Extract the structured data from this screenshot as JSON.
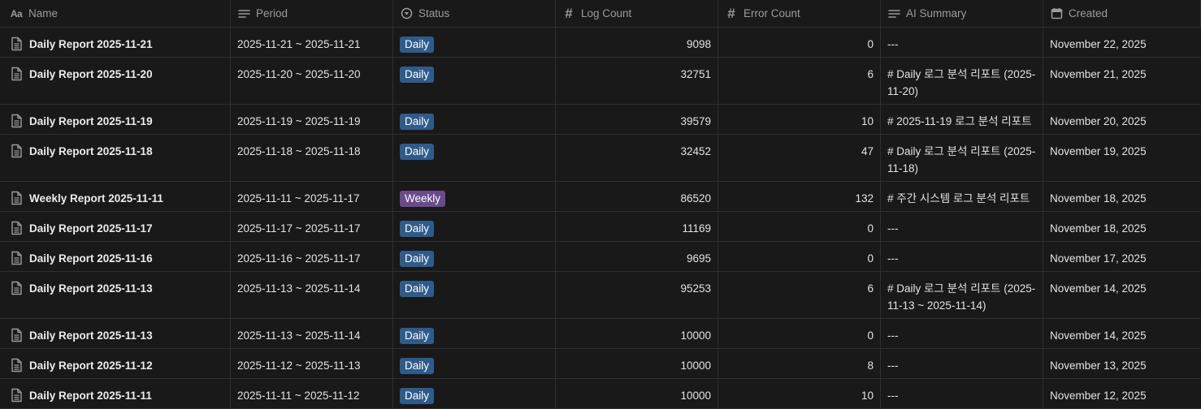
{
  "columns": {
    "name": {
      "label": "Name",
      "icon": "text-aa-icon"
    },
    "period": {
      "label": "Period",
      "icon": "lines-icon"
    },
    "status": {
      "label": "Status",
      "icon": "status-icon"
    },
    "log_count": {
      "label": "Log Count",
      "icon": "hash-icon"
    },
    "error_count": {
      "label": "Error Count",
      "icon": "hash-icon"
    },
    "ai_summary": {
      "label": "AI Summary",
      "icon": "lines-icon"
    },
    "created": {
      "label": "Created",
      "icon": "calendar-icon"
    }
  },
  "status_colors": {
    "Daily": "#2f5b8a",
    "Weekly": "#6a4a8c"
  },
  "rows": [
    {
      "name": "Daily Report 2025-11-21",
      "period": "2025-11-21 ~ 2025-11-21",
      "status": "Daily",
      "log_count": "9098",
      "error_count": "0",
      "ai_summary": "---",
      "created": "November 22, 2025"
    },
    {
      "name": "Daily Report 2025-11-20",
      "period": "2025-11-20 ~ 2025-11-20",
      "status": "Daily",
      "log_count": "32751",
      "error_count": "6",
      "ai_summary": "# Daily 로그 분석 리포트 (2025-11-20)",
      "created": "November 21, 2025"
    },
    {
      "name": "Daily Report 2025-11-19",
      "period": "2025-11-19 ~ 2025-11-19",
      "status": "Daily",
      "log_count": "39579",
      "error_count": "10",
      "ai_summary": "# 2025-11-19 로그 분석 리포트",
      "created": "November 20, 2025"
    },
    {
      "name": "Daily Report 2025-11-18",
      "period": "2025-11-18 ~ 2025-11-18",
      "status": "Daily",
      "log_count": "32452",
      "error_count": "47",
      "ai_summary": "# Daily 로그 분석 리포트 (2025-11-18)",
      "created": "November 19, 2025"
    },
    {
      "name": "Weekly Report 2025-11-11",
      "period": "2025-11-11 ~ 2025-11-17",
      "status": "Weekly",
      "log_count": "86520",
      "error_count": "132",
      "ai_summary": "# 주간 시스템 로그 분석 리포트",
      "created": "November 18, 2025"
    },
    {
      "name": "Daily Report 2025-11-17",
      "period": "2025-11-17 ~ 2025-11-17",
      "status": "Daily",
      "log_count": "11169",
      "error_count": "0",
      "ai_summary": "---",
      "created": "November 18, 2025"
    },
    {
      "name": "Daily Report 2025-11-16",
      "period": "2025-11-16 ~ 2025-11-17",
      "status": "Daily",
      "log_count": "9695",
      "error_count": "0",
      "ai_summary": "---",
      "created": "November 17, 2025"
    },
    {
      "name": "Daily Report 2025-11-13",
      "period": "2025-11-13 ~ 2025-11-14",
      "status": "Daily",
      "log_count": "95253",
      "error_count": "6",
      "ai_summary": "# Daily 로그 분석 리포트 (2025-11-13 ~ 2025-11-14)",
      "created": "November 14, 2025"
    },
    {
      "name": "Daily Report 2025-11-13",
      "period": "2025-11-13 ~ 2025-11-14",
      "status": "Daily",
      "log_count": "10000",
      "error_count": "0",
      "ai_summary": "---",
      "created": "November 14, 2025"
    },
    {
      "name": "Daily Report 2025-11-12",
      "period": "2025-11-12 ~ 2025-11-13",
      "status": "Daily",
      "log_count": "10000",
      "error_count": "8",
      "ai_summary": "---",
      "created": "November 13, 2025"
    },
    {
      "name": "Daily Report 2025-11-11",
      "period": "2025-11-11 ~ 2025-11-12",
      "status": "Daily",
      "log_count": "10000",
      "error_count": "10",
      "ai_summary": "---",
      "created": "November 12, 2025"
    }
  ]
}
